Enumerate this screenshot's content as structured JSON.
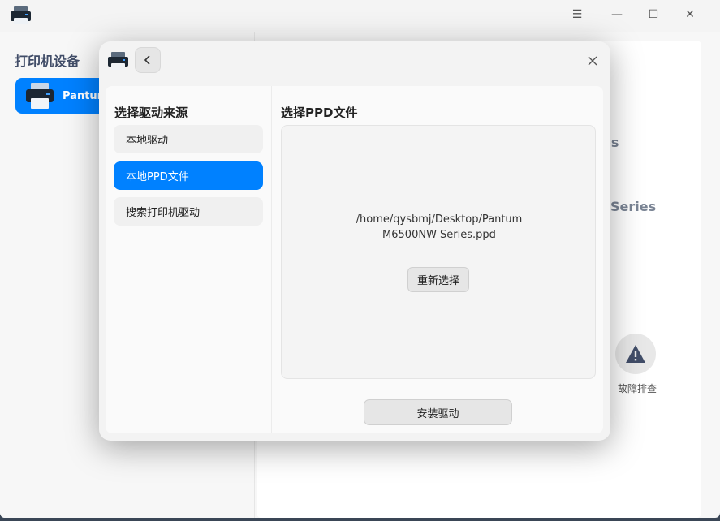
{
  "window": {
    "menu_glyph": "☰",
    "minimize_glyph": "—",
    "maximize_glyph": "☐",
    "close_glyph": "✕"
  },
  "sidebar": {
    "title": "打印机设备",
    "devices": [
      {
        "label": "Pantum",
        "icon": "printer-icon",
        "selected": true
      }
    ]
  },
  "background": {
    "fragment_1": "es",
    "fragment_2": "Series",
    "troubleshoot_label": "故障排查",
    "troubleshoot_icon": "warning-icon"
  },
  "dialog": {
    "back_glyph": "‹",
    "close_glyph": "✕",
    "left": {
      "title": "选择驱动来源",
      "items": [
        {
          "label": "本地驱动",
          "selected": false
        },
        {
          "label": "本地PPD文件",
          "selected": true
        },
        {
          "label": "搜索打印机驱动",
          "selected": false
        }
      ]
    },
    "right": {
      "title": "选择PPD文件",
      "file_path_line1": "/home/qysbmj/Desktop/Pantum",
      "file_path_line2": "M6500NW Series.ppd",
      "reselect_label": "重新选择"
    },
    "install_label": "安装驱动"
  },
  "colors": {
    "accent": "#0081ff",
    "title_text": "#414d68"
  }
}
